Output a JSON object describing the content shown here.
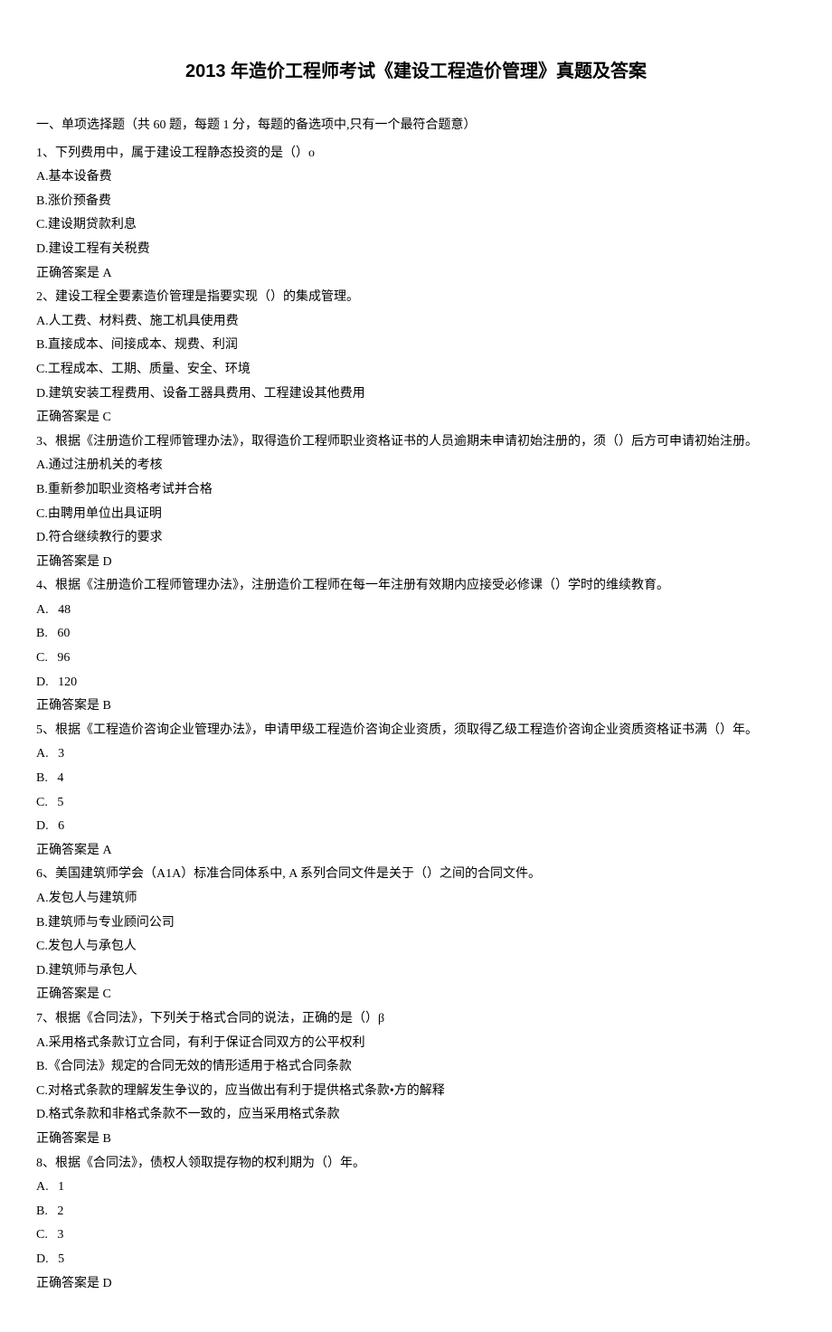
{
  "title": "2013 年造价工程师考试《建设工程造价管理》真题及答案",
  "section_header": "一、单项选择题（共 60 题，每题 1 分，每题的备选项中,只有一个最符合题意）",
  "questions": [
    {
      "stem": "1、下列费用中，属于建设工程静态投资的是（）o",
      "options": [
        "A.基本设备费",
        "B.涨价预备费",
        "C.建设期贷款利息",
        "D.建设工程有关税费"
      ],
      "answer": "正确答案是 A"
    },
    {
      "stem": "2、建设工程全要素造价管理是指要实现（）的集成管理。",
      "options": [
        "A.人工费、材料费、施工机具使用费",
        "B.直接成本、间接成本、规费、利润",
        "C.工程成本、工期、质量、安全、环境",
        "D.建筑安装工程费用、设备工器具费用、工程建设其他费用"
      ],
      "answer": "正确答案是 C"
    },
    {
      "stem": "3、根据《注册造价工程师管理办法》，取得造价工程师职业资格证书的人员逾期未申请初始注册的，须（）后方可申请初始注册。",
      "options": [
        "A.通过注册机关的考核",
        "B.重新参加职业资格考试并合格",
        "C.由聘用单位出具证明",
        "D.符合继续教行的要求"
      ],
      "answer": "正确答案是 D"
    },
    {
      "stem": "4、根据《注册造价工程师管理办法》，注册造价工程师在每一年注册有效期内应接受必修课（）学时的维续教育。",
      "options": [
        "A.   48",
        "B.   60",
        "C.   96",
        "D.   120"
      ],
      "answer": "正确答案是 B"
    },
    {
      "stem": "5、根据《工程造价咨询企业管理办法》，申请甲级工程造价咨询企业资质，须取得乙级工程造价咨询企业资质资格证书满（）年。",
      "options": [
        "A.   3",
        "B.   4",
        "C.   5",
        "D.   6"
      ],
      "answer": "正确答案是 A"
    },
    {
      "stem": "6、美国建筑师学会（A1A）标准合同体系中, A 系列合同文件是关于（）之间的合同文件。",
      "options": [
        "A.发包人与建筑师",
        "B.建筑师与专业顾问公司",
        "C.发包人与承包人",
        "D.建筑师与承包人"
      ],
      "answer": "正确答案是 C"
    },
    {
      "stem": "7、根据《合同法》，下列关于格式合同的说法，正确的是（）β",
      "options": [
        "A.采用格式条款订立合同，有利于保证合同双方的公平权利",
        "B.《合同法》规定的合同无效的情形适用于格式合同条款",
        "C.对格式条款的理解发生争议的，应当做出有利于提供格式条款•方的解释",
        "D.格式条款和非格式条款不一致的，应当采用格式条款"
      ],
      "answer": "正确答案是 B"
    },
    {
      "stem": "8、根据《合同法》，债权人领取提存物的权利期为（）年。",
      "options": [
        "A.   1",
        "B.   2",
        "C.   3",
        "D.   5"
      ],
      "answer": "正确答案是 D"
    }
  ]
}
